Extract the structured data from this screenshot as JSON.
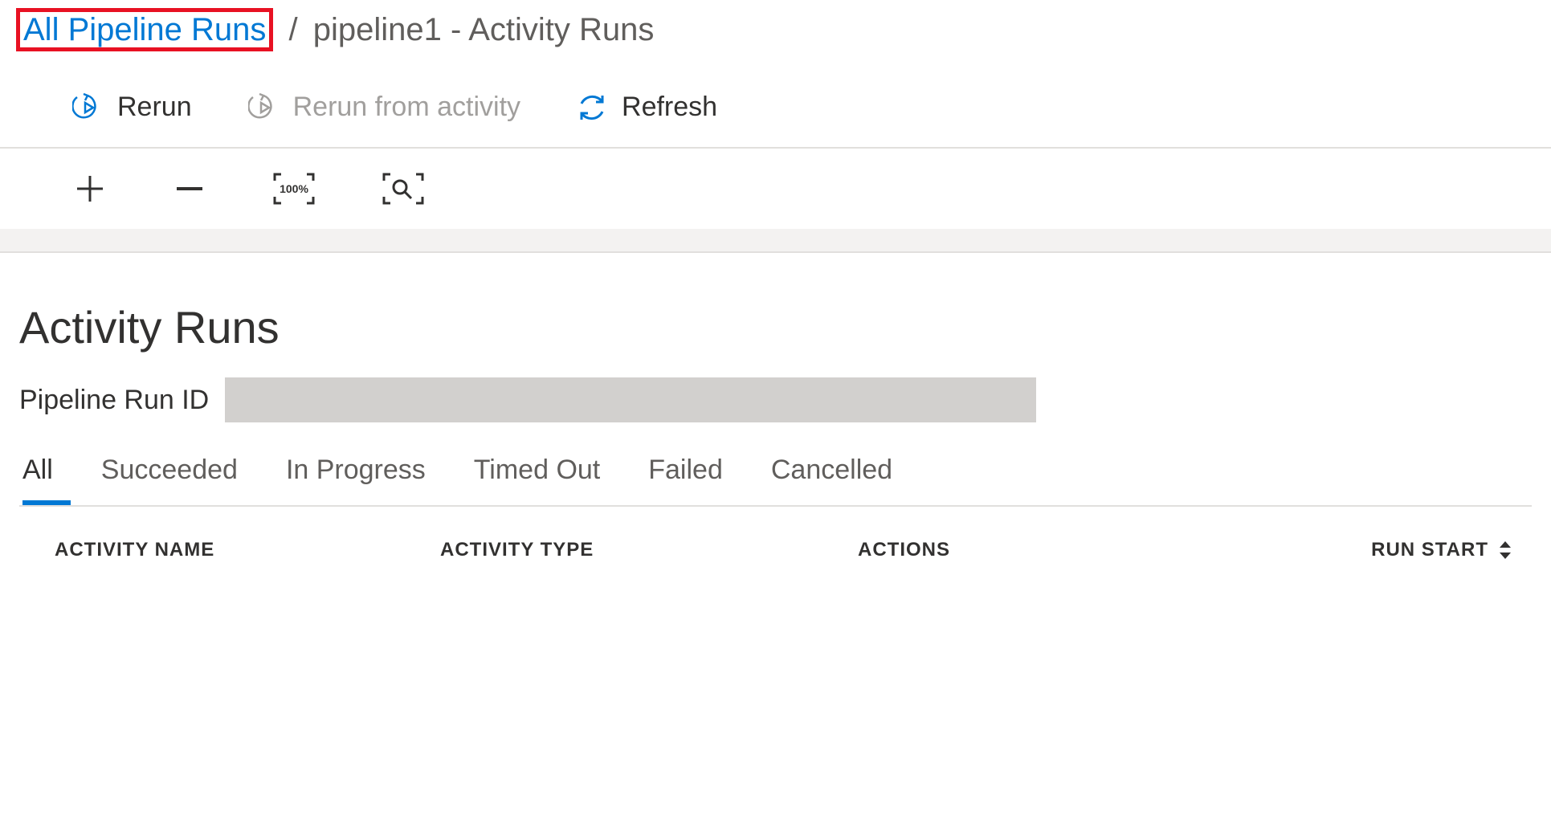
{
  "breadcrumb": {
    "link_label": "All Pipeline Runs",
    "separator": "/",
    "current": "pipeline1 - Activity Runs"
  },
  "commands": {
    "rerun": "Rerun",
    "rerun_from_activity": "Rerun from activity",
    "refresh": "Refresh"
  },
  "zoom": {
    "fit_label": "100%"
  },
  "section": {
    "heading": "Activity Runs",
    "run_id_label": "Pipeline Run ID",
    "run_id_value": ""
  },
  "status_tabs": [
    "All",
    "Succeeded",
    "In Progress",
    "Timed Out",
    "Failed",
    "Cancelled"
  ],
  "active_tab": "All",
  "table": {
    "headers": {
      "activity_name": "ACTIVITY NAME",
      "activity_type": "ACTIVITY TYPE",
      "actions": "ACTIONS",
      "run_start": "RUN START"
    }
  },
  "colors": {
    "accent": "#0078d4",
    "highlight_border": "#e81123"
  }
}
